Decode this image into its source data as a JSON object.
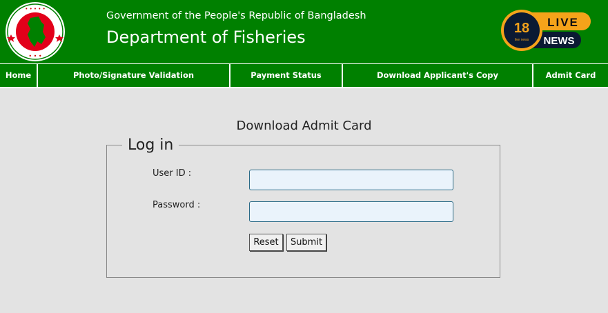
{
  "header": {
    "gov_title": "Government of the People's Republic of Bangladesh",
    "dept_title": "Department of Fisheries"
  },
  "live_badge": {
    "number": "18",
    "small_text": "live news",
    "live": "LIVE",
    "news": "NEWS"
  },
  "nav": [
    {
      "label": "Home"
    },
    {
      "label": "Photo/Signature Validation"
    },
    {
      "label": "Payment Status"
    },
    {
      "label": "Download Applicant's Copy"
    },
    {
      "label": "Admit Card"
    }
  ],
  "page_heading": "Download Admit Card",
  "login": {
    "legend": "Log in",
    "user_id_label": "User ID :",
    "user_id_value": "",
    "password_label": "Password :",
    "password_value": "",
    "reset_label": "Reset",
    "submit_label": "Submit"
  },
  "colors": {
    "brand_green": "#008000",
    "seal_red": "#e2001a",
    "badge_orange": "#f5a31a",
    "badge_navy": "#0b1a33"
  }
}
